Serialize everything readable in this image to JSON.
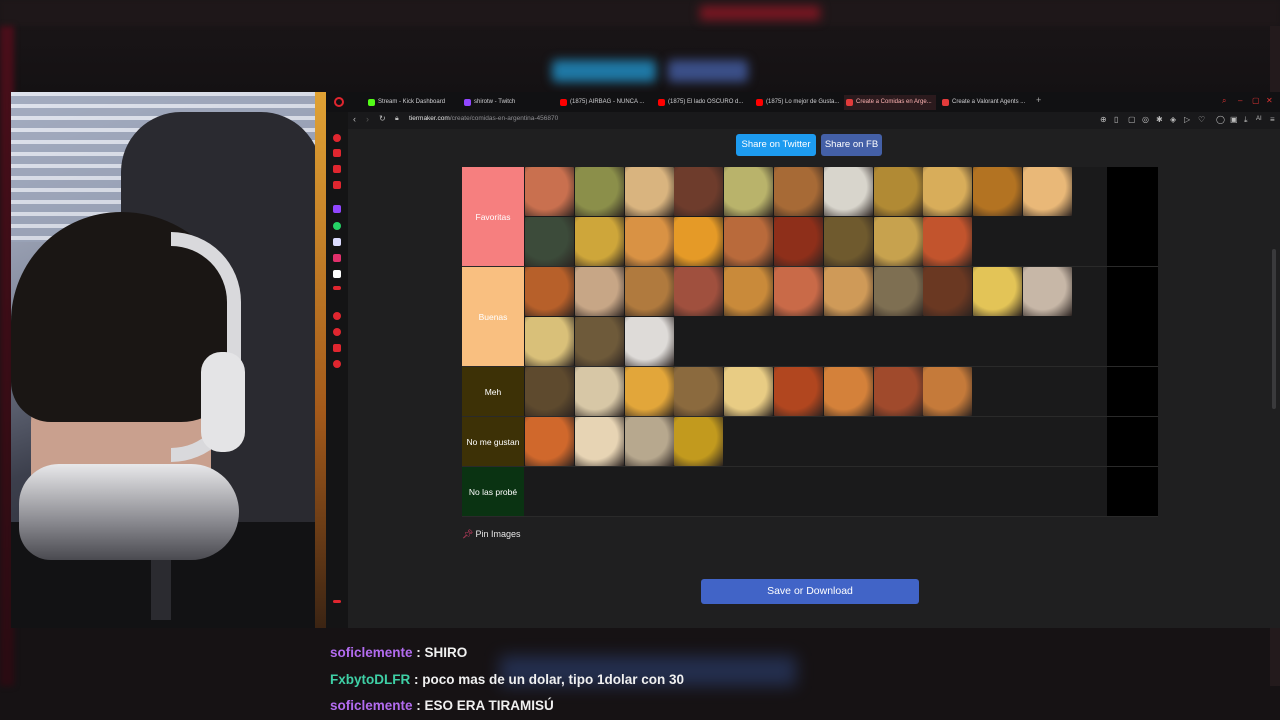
{
  "browser": {
    "tabs": [
      {
        "label": "Stream - Kick Dashboard",
        "favicon_color": "#53fc18"
      },
      {
        "label": "shirotw - Twitch",
        "favicon_color": "#9146ff"
      },
      {
        "label": "(1875) AIRBAG - NUNCA ...",
        "favicon_color": "#ff0000"
      },
      {
        "label": "(1875) El lado OSCURO d...",
        "favicon_color": "#ff0000"
      },
      {
        "label": "(1875) Lo mejor de Gusta...",
        "favicon_color": "#ff0000"
      },
      {
        "label": "Create a Comidas en Arge...",
        "favicon_color": "#e23b3b",
        "active": true
      },
      {
        "label": "Create a Valorant Agents ...",
        "favicon_color": "#e23b3b"
      }
    ],
    "url_host": "tiermaker.com",
    "url_path": "/create/comidas-en-argentina-456870",
    "ai_label": "AI"
  },
  "page": {
    "share_twitter": "Share on Twitter",
    "share_fb": "Share on FB",
    "pin_images": "Pin Images",
    "save_download": "Save or Download",
    "tiers": [
      {
        "label": "Favoritas",
        "color": "#f67f7f",
        "item_colors": [
          "#c9704f",
          "#8b8f4a",
          "#d9b47f",
          "#6e3c2c",
          "#b9b36b",
          "#a76a36",
          "#d8d5cc",
          "#b18a34",
          "#d8ad5a",
          "#b37322",
          "#e9b878",
          "#3c4b3a",
          "#cea63a",
          "#d99244",
          "#e59a27",
          "#b96a3b",
          "#8e2f1a",
          "#6f5a2e",
          "#c7a24e",
          "#c2542d"
        ]
      },
      {
        "label": "Buenas",
        "color": "#f9bf80",
        "item_colors": [
          "#b7602a",
          "#c7a686",
          "#b07a3e",
          "#a0503e",
          "#c98a3a",
          "#c96a48",
          "#cf9a58",
          "#7e6f52",
          "#6a3822",
          "#e3c457",
          "#c7b7a7",
          "#d9c079",
          "#6e5a3a",
          "#dedbd8"
        ]
      },
      {
        "label": "Meh",
        "color": "#3d3106",
        "item_colors": [
          "#5e4a2e",
          "#d7c7a6",
          "#e2a63a",
          "#8b6a3e",
          "#e8cc84",
          "#b1461f",
          "#d4813a",
          "#a04a2c",
          "#c57a3a"
        ]
      },
      {
        "label": "No me gustan",
        "color": "#3d3106",
        "item_colors": [
          "#d0682c",
          "#e7d4b4",
          "#b7a88e",
          "#c29a1e"
        ]
      },
      {
        "label": "No las probé",
        "color": "#0a3312",
        "item_colors": []
      }
    ]
  },
  "chat": [
    {
      "user": "soficlemente",
      "user_color": "#b36cf0",
      "message": ": SHIRO"
    },
    {
      "user": "FxbytoDLFR",
      "user_color": "#3fd0a6",
      "message": ": poco mas de un dolar, tipo 1dolar con 30"
    },
    {
      "user": "soficlemente",
      "user_color": "#b36cf0",
      "message": ": ESO ERA TIRAMISÚ"
    }
  ]
}
